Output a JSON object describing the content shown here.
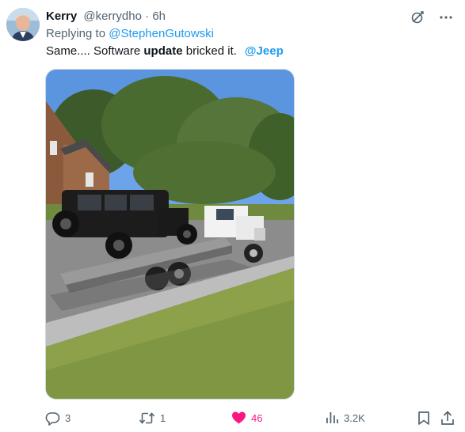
{
  "author": {
    "display_name": "Kerry",
    "handle": "@kerrydho",
    "separator": "·",
    "time": "6h"
  },
  "reply": {
    "prefix": "Replying to",
    "mention": "@StephenGutowski"
  },
  "text": {
    "part1": "Same.... Software ",
    "bold": "update",
    "part2": " bricked it.",
    "mention": "@Jeep"
  },
  "icons": {
    "top": [
      "grok-icon",
      "more-icon"
    ],
    "actions": [
      "reply-icon",
      "retweet-icon",
      "like-icon",
      "views-icon",
      "bookmark-icon",
      "share-icon"
    ]
  },
  "actions": {
    "replies": "3",
    "retweets": "1",
    "likes": "46",
    "views": "3.2K"
  },
  "colors": {
    "accent": "#1d9bf0",
    "like": "#f91880",
    "secondary_text": "#536471"
  }
}
